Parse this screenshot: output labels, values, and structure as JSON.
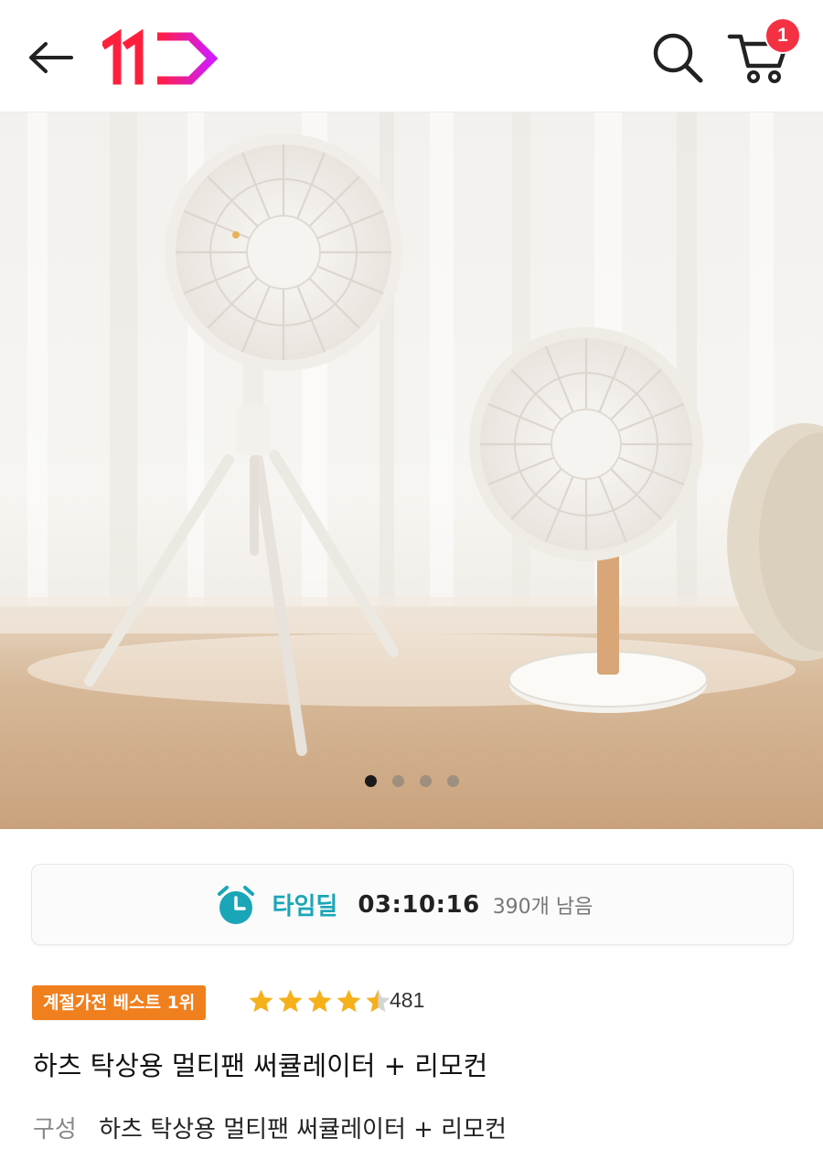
{
  "header": {
    "back_icon": "arrow-left-icon",
    "logo": {
      "text": "11",
      "brand_color": "#ff0038",
      "accent_color": "#c31cff"
    },
    "search_icon": "search-icon",
    "cart_icon": "cart-icon",
    "cart_count": "1",
    "badge_color": "#f43142"
  },
  "gallery": {
    "image": "two-white-fans-photo",
    "slide_count": 4,
    "active_index": 0
  },
  "timedeal": {
    "icon": "alarm-clock-icon",
    "label": "타임딜",
    "countdown": "03:10:16",
    "remaining": "390개 남음",
    "accent_color": "#1aa6b7"
  },
  "product": {
    "best_badge": "계절가전 베스트 1위",
    "badge_color": "#f07f1d",
    "rating": 4.5,
    "max_rating": 5,
    "star_color": "#f5b01a",
    "review_count": "481",
    "title": "하츠 탁상용 멀티팬 써큘레이터 + 리모컨",
    "option_label": "구성",
    "option_value": "하츠 탁상용 멀티팬 써큘레이터 + 리모컨"
  }
}
